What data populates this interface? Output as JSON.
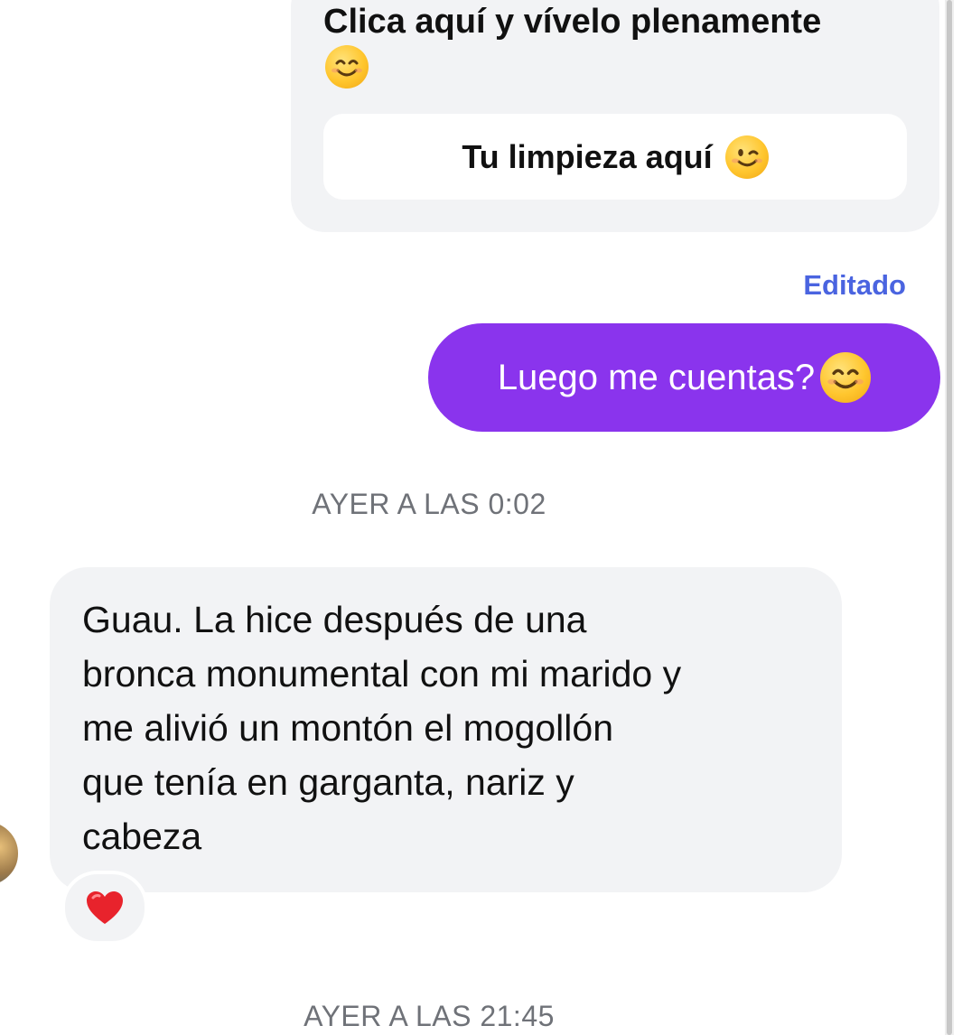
{
  "card": {
    "text": "Clica aquí y vívelo plenamente",
    "text_emoji": "smiling-face-with-smiling-eyes",
    "button_label": "Tu limpieza aquí",
    "button_emoji": "winking-face"
  },
  "outgoing": {
    "edited_label": "Editado",
    "message": "Luego me cuentas?",
    "message_emoji": "smiling-face-with-smiling-eyes"
  },
  "timestamps": {
    "first": "AYER A LAS 0:02",
    "second": "AYER A LAS 21:45"
  },
  "incoming": {
    "message": "Guau. La hice después de una\nbronca monumental con mi marido y\nme alivió un montón el mogollón\nque tenía en garganta, nariz y\ncabeza",
    "reaction": "red-heart"
  },
  "colors": {
    "outgoing_bubble": "#8a34ed",
    "incoming_bubble": "#f2f3f5",
    "edited_label": "#4a64e0",
    "timestamp": "#6f7278"
  }
}
